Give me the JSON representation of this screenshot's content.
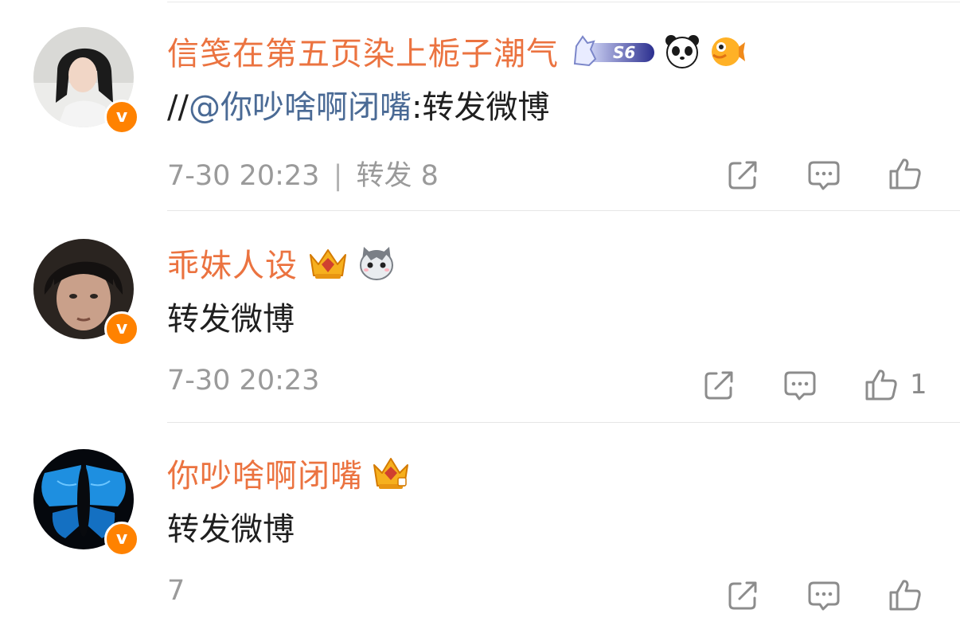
{
  "posts": [
    {
      "username": "信笺在第五页染上栀子潮气",
      "level_badge_text": "S6",
      "badges": [
        "svip-unicorn-badge",
        "panda-emoji-icon",
        "pufferfish-emoji-icon"
      ],
      "content_prefix": "//",
      "mention": "@你吵啥啊闭嘴",
      "content_suffix": ":转发微博",
      "timestamp": "7-30 20:23",
      "separator": "|",
      "repost_label": "转发 8",
      "like_count": ""
    },
    {
      "username": "乖妹人设",
      "badges": [
        "crown-badge",
        "cat-emoji-icon"
      ],
      "content": "转发微博",
      "timestamp": "7-30 20:23",
      "like_count": "1"
    },
    {
      "username": "你吵啥啊闭嘴",
      "badges": [
        "crown-badge"
      ],
      "content": "转发微博",
      "timestamp": "7",
      "like_count": ""
    }
  ],
  "verified_mark": "v",
  "colors": {
    "username": "#eb7340",
    "mention": "#4a6a95",
    "meta": "#9a9a9a",
    "verified": "#ff8200"
  }
}
